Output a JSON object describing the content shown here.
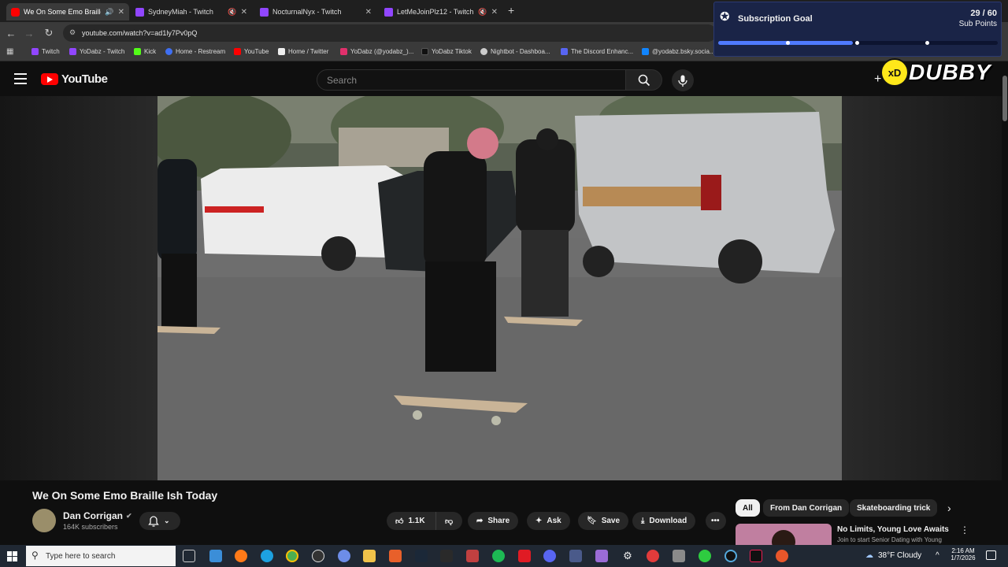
{
  "browser": {
    "tabs": [
      {
        "label": "We On Some Emo Braille Is",
        "icon": "youtube-favicon",
        "active": true
      },
      {
        "label": "SydneyMiah - Twitch",
        "icon": "twitch-favicon"
      },
      {
        "label": "NocturnalNyx - Twitch",
        "icon": "twitch-favicon"
      },
      {
        "label": "LetMeJoinPlz12 - Twitch",
        "icon": "twitch-favicon"
      }
    ],
    "new_tab": "+",
    "url": "youtube.com/watch?v=ad1ly7Pv0pQ",
    "bookmarks": [
      {
        "label": "Twitch",
        "color": "#9146ff"
      },
      {
        "label": "YoDabz - Twitch",
        "color": "#9146ff"
      },
      {
        "label": "Kick",
        "color": "#53fc18"
      },
      {
        "label": "Home - Restream",
        "color": "#3f6ff2"
      },
      {
        "label": "YouTube",
        "color": "#ff0000"
      },
      {
        "label": "Home / Twitter",
        "color": "#ffffff"
      },
      {
        "label": "YoDabz (@yodabz_)...",
        "color": "#e1306c"
      },
      {
        "label": "YoDabz Tiktok",
        "color": "#111111"
      },
      {
        "label": "Nightbot - Dashboa...",
        "color": "#cccccc"
      },
      {
        "label": "The Discord Enhanc...",
        "color": "#5865f2"
      },
      {
        "label": "@yodabz.bsky.socia...",
        "color": "#1185fe"
      }
    ]
  },
  "youtube": {
    "logo_text": "YouTube",
    "search_placeholder": "Search"
  },
  "overlay": {
    "goal_title": "Subscription Goal",
    "goal_count": "29 / 60",
    "goal_unit": "Sub Points",
    "goal_progress": 0.483,
    "streamer_logo": "DUBBY"
  },
  "video": {
    "title": "We On Some Emo Braille Ish Today",
    "channel_name": "Dan Corrigan",
    "subscribers": "164K subscribers",
    "likes": "1.1K",
    "actions": {
      "share": "Share",
      "ask": "Ask",
      "save": "Save",
      "download": "Download"
    }
  },
  "sidebar": {
    "chips": [
      "All",
      "From Dan Corrigan",
      "Skateboarding trick"
    ],
    "ad_title": "No Limits, Young Love Awaits",
    "ad_subtitle": "Join to start Senior Dating with Young"
  },
  "taskbar": {
    "search_placeholder": "Type here to search",
    "weather": "38°F  Cloudy",
    "time": "2:16 AM",
    "date": "1/7/2026"
  }
}
